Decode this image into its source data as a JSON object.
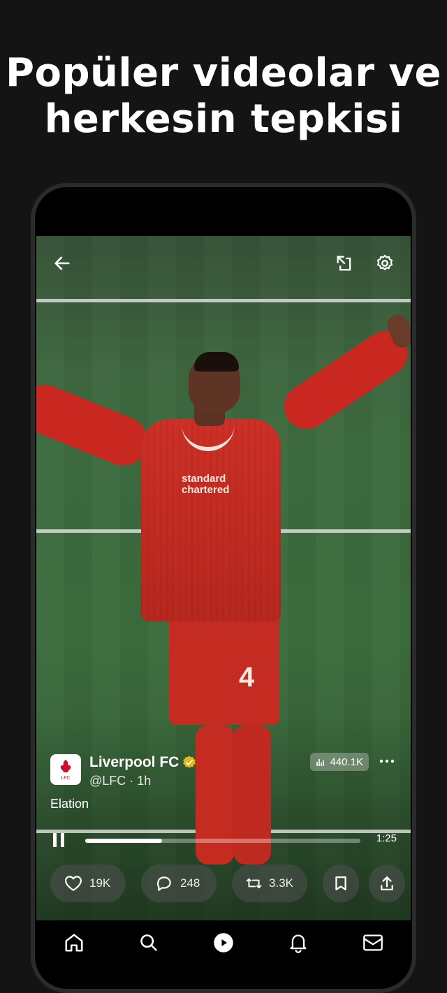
{
  "headline": {
    "line1": "Popüler videolar ve",
    "line2": "herkesin tepkisi"
  },
  "video": {
    "player_shorts_number": "4",
    "sponsor_text_1": "standard",
    "sponsor_text_2": "chartered",
    "progress": 0.28
  },
  "topbar": {
    "back_icon": "arrow-left-icon",
    "minimize_icon": "picture-in-picture-icon",
    "settings_icon": "gear-icon"
  },
  "post": {
    "author_name": "Liverpool FC",
    "verified_icon": "gold-verified-badge-icon",
    "avatar_text": "LFC",
    "handle_time": "@LFC · 1h",
    "views": "440.1K",
    "caption": "Elation",
    "duration": "1:25"
  },
  "actions": {
    "likes": "19K",
    "replies": "248",
    "reposts": "3.3K"
  },
  "nav": [
    "home-icon",
    "search-icon",
    "video-play-icon",
    "bell-icon",
    "mail-icon"
  ],
  "colors": {
    "background": "#141414",
    "verified": "#e2b719",
    "jersey": "#c42c22"
  }
}
